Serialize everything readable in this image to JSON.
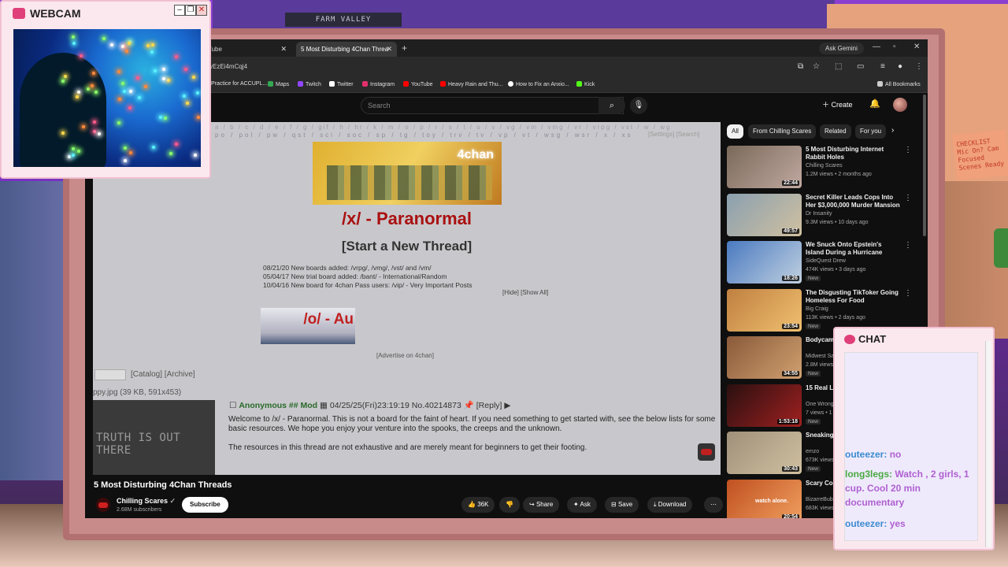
{
  "shelf": {
    "label": "FARM VALLEY"
  },
  "sticky_note": {
    "text": "CHECKLIST Mic On? Cam Focused Scenes Ready"
  },
  "browser": {
    "tabs": [
      {
        "label": "Tube",
        "active": false
      },
      {
        "label": "5 Most Disturbing 4Chan Threa",
        "active": true
      }
    ],
    "ask_gemini": "Ask Gemini",
    "url": "vEzEi4mCqj4",
    "bookmarks": [
      "Practice for ACCUPL...",
      "Maps",
      "Twitch",
      "Twitter",
      "Instagram",
      "YouTube",
      "Heavy Rain and Thu...",
      "How to Fix an Anxio...",
      "Kick"
    ],
    "all_bookmarks": "All Bookmarks",
    "bookmark_colors": [
      "#e05a4a",
      "#34a853",
      "#9146ff",
      "#ffffff",
      "#e1306c",
      "#ff0000",
      "#ff0000",
      "#ffffff",
      "#53fc18"
    ]
  },
  "youtube": {
    "search_placeholder": "Search",
    "create": "Create",
    "video": {
      "title": "5 Most Disturbing 4Chan Threads",
      "channel": "Chilling Scares",
      "subscribers": "2.68M subscribers",
      "subscribe": "Subscribe",
      "likes": "36K",
      "share": "Share",
      "ask": "Ask",
      "save": "Save",
      "download": "Download"
    },
    "player": {
      "board_nav": "a / b / c / d / e / f / g / gif / h / hr / k / m / o / p / r / s / t / u / v / vg / vm / vmg / vr / vrpg / vst / w / wg",
      "board_nav2": "po / pol / pw / qst / sci / soc / sp / tg / toy / trv / tv / vp / vt / wsg / wsr / x / xs",
      "nav_settings": "[Settings] [Search]",
      "banner_label": "4chan",
      "board_title": "/x/ - Paranormal",
      "thread_title": "[Start a New Thread]",
      "news": [
        "08/21/20  New boards added: /vrpg/, /vmg/, /vst/ and /vm/",
        "05/04/17  New trial board added: /bant/ - International/Random",
        "10/04/16  New board for 4chan Pass users: /vip/ - Very Important Posts"
      ],
      "hide_show": "[Hide] [Show All]",
      "ad_label": "/o/ - Au",
      "advertise": "[Advertise on 4chan]",
      "catalog": "[Catalog] [Archive]",
      "file_info": "ppy.jpg (39 KB, 591x453)",
      "thumb_text": "TRUTH IS OUT THERE",
      "post_name": "Anonymous ## Mod",
      "post_date": "04/25/25(Fri)23:19:19 No.40214873",
      "post_reply": "[Reply]",
      "post_body_1": "Welcome to /x/ - Paranormal. This is not a board for the faint of heart. If you need something to get started with, see the below lists for some basic resources. We hope you enjoy your venture into the spooks, the creeps and the unknown.",
      "post_body_2": "The resources in this thread are not exhaustive and are merely meant for beginners to get their footing."
    },
    "chips": [
      "All",
      "From Chilling Scares",
      "Related",
      "For you"
    ],
    "recommendations": [
      {
        "title": "5 Most Disturbing Internet Rabbit Holes",
        "channel": "Chilling Scares",
        "meta": "1.2M views • 2 months ago",
        "duration": "22:44",
        "new": "",
        "colors": [
          "#7a6a5a",
          "#c0a8a0"
        ]
      },
      {
        "title": "Secret Killer Leads Cops Into Her $3,000,000 Murder Mansion",
        "channel": "Dr Insanity",
        "meta": "9.3M views • 10 days ago",
        "duration": "49:57",
        "new": "",
        "colors": [
          "#8aa0b0",
          "#d0c0a0"
        ]
      },
      {
        "title": "We Snuck Onto Epstein's Island During a Hurricane",
        "channel": "SideQuest Drew",
        "meta": "474K views • 3 days ago",
        "duration": "18:26",
        "new": "New",
        "colors": [
          "#4a7ac0",
          "#c0d0e0"
        ]
      },
      {
        "title": "The Disgusting TikToker Going Homeless For Food",
        "channel": "Big Craig",
        "meta": "113K views • 2 days ago",
        "duration": "23:54",
        "new": "New",
        "colors": [
          "#c08040",
          "#f0c070"
        ]
      },
      {
        "title": "Bodycam Sword Ma",
        "channel": "Midwest Sa",
        "meta": "2.8M views",
        "duration": "34:55",
        "new": "New",
        "colors": [
          "#8a5a3a",
          "#d0a070"
        ]
      },
      {
        "title": "15 Real Li Lonely Ni",
        "channel": "One Wrong",
        "meta": "7 views • 1",
        "duration": "1:53:18",
        "new": "New",
        "colors": [
          "#2a1010",
          "#a02020"
        ]
      },
      {
        "title": "Sneaking Rothschil",
        "channel": "emzo",
        "meta": "673K views",
        "duration": "30:43",
        "new": "New",
        "colors": [
          "#a0907a",
          "#d0c0a0"
        ]
      },
      {
        "title": "Scary Cor",
        "channel": "BizarreBub",
        "meta": "683K views",
        "duration": "20:54",
        "new": "",
        "colors": [
          "#c05020",
          "#f0a060"
        ],
        "overlay": "watch alone."
      }
    ]
  },
  "webcam": {
    "title": "WEBCAM"
  },
  "chat": {
    "title": "CHAT",
    "messages": [
      {
        "user": "outeezer",
        "text": "no",
        "user_color": "blue"
      },
      {
        "user": "long3legs",
        "text": "Watch , 2 girls, 1 cup. Cool 20 min documentary",
        "user_color": "green"
      },
      {
        "user": "outeezer",
        "text": "yes",
        "user_color": "blue"
      }
    ]
  }
}
